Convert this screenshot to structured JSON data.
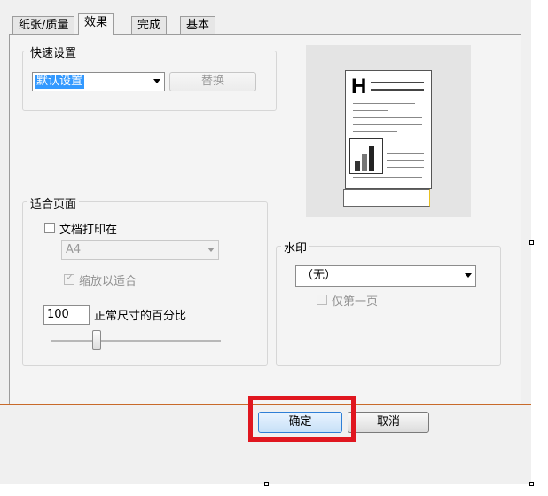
{
  "tabs": [
    "纸张/质量",
    "效果",
    "完成",
    "基本"
  ],
  "quick_settings": {
    "title": "快速设置",
    "preset_value": "默认设置",
    "replace_button": "替换"
  },
  "fit_page": {
    "title": "适合页面",
    "print_document_on_label": "文档打印在",
    "paper_value": "A4",
    "scale_to_fit_label": "缩放以适合",
    "percent_value": "100",
    "percent_label": "正常尺寸的百分比",
    "scale_slider_position": 0.27
  },
  "watermark": {
    "title": "水印",
    "value": "（无）",
    "first_page_only_label": "仅第一页"
  },
  "footer": {
    "ok_button": "确定",
    "cancel_button": "取消"
  },
  "colors": {
    "highlight_box": "#e0161f",
    "selection": "#3399ff",
    "ok_default_border": "#2f7fd6"
  }
}
